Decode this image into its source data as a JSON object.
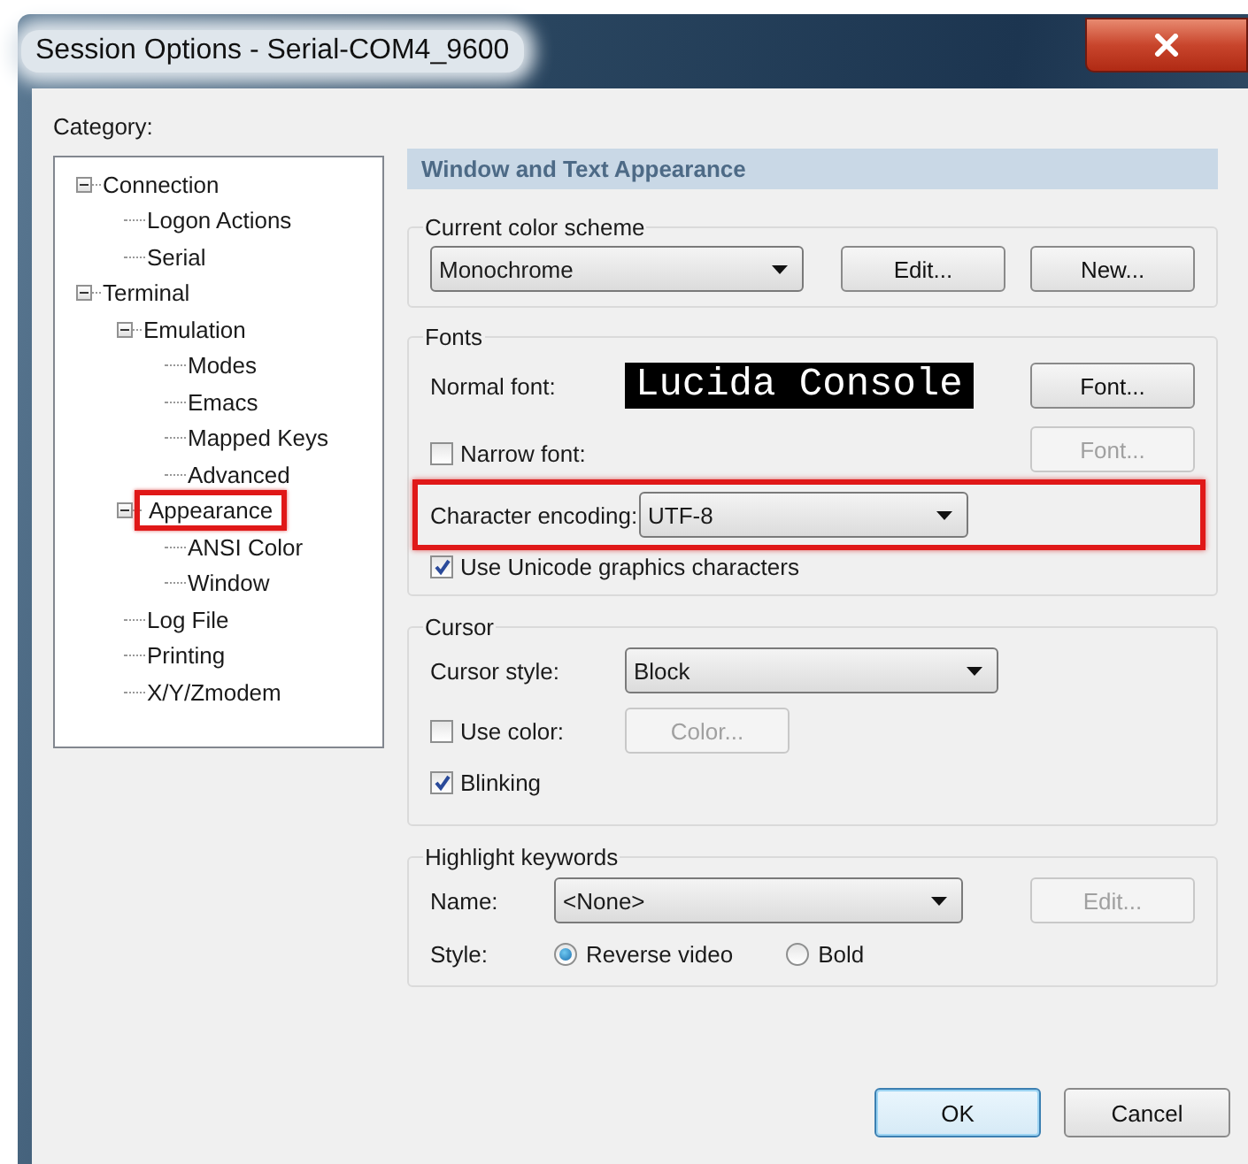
{
  "window": {
    "title": "Session Options - Serial-COM4_9600"
  },
  "category": {
    "label": "Category:",
    "tree": [
      {
        "label": "Connection",
        "expanded": true,
        "children": [
          {
            "label": "Logon Actions"
          },
          {
            "label": "Serial"
          }
        ]
      },
      {
        "label": "Terminal",
        "expanded": true,
        "children": [
          {
            "label": "Emulation",
            "expanded": true,
            "children": [
              {
                "label": "Modes"
              },
              {
                "label": "Emacs"
              },
              {
                "label": "Mapped Keys"
              },
              {
                "label": "Advanced"
              }
            ]
          },
          {
            "label": "Appearance",
            "expanded": true,
            "highlighted": true,
            "children": [
              {
                "label": "ANSI Color"
              },
              {
                "label": "Window"
              }
            ]
          },
          {
            "label": "Log File"
          },
          {
            "label": "Printing"
          },
          {
            "label": "X/Y/Zmodem"
          }
        ]
      }
    ]
  },
  "panel": {
    "title": "Window and Text Appearance",
    "color_scheme": {
      "label": "Current color scheme",
      "value": "Monochrome",
      "buttons": [
        {
          "label": "Edit...",
          "disabled": false
        },
        {
          "label": "New...",
          "disabled": false
        }
      ]
    },
    "fonts": {
      "label": "Fonts",
      "normal_font": {
        "label": "Normal font:",
        "preview": "Lucida Console",
        "button": {
          "label": "Font...",
          "disabled": false
        }
      },
      "narrow_font": {
        "label": "Narrow font:",
        "checked": false,
        "button": {
          "label": "Font...",
          "disabled": true
        }
      },
      "encoding": {
        "label": "Character encoding:",
        "value": "UTF-8",
        "highlighted": true
      },
      "unicode_graphics": {
        "label": "Use Unicode graphics characters",
        "checked": true
      }
    },
    "cursor": {
      "label": "Cursor",
      "style": {
        "label": "Cursor style:",
        "value": "Block"
      },
      "use_color": {
        "label": "Use color:",
        "checked": false,
        "button": {
          "label": "Color...",
          "disabled": true
        }
      },
      "blinking": {
        "label": "Blinking",
        "checked": true
      }
    },
    "highlight_keywords": {
      "label": "Highlight keywords",
      "name": {
        "label": "Name:",
        "value": "<None>",
        "button": {
          "label": "Edit...",
          "disabled": true
        }
      },
      "style": {
        "label": "Style:",
        "options": [
          {
            "label": "Reverse video",
            "selected": true
          },
          {
            "label": "Bold",
            "selected": false
          }
        ]
      }
    }
  },
  "buttons": [
    {
      "label": "OK",
      "default": true
    },
    {
      "label": "Cancel",
      "default": false
    }
  ]
}
